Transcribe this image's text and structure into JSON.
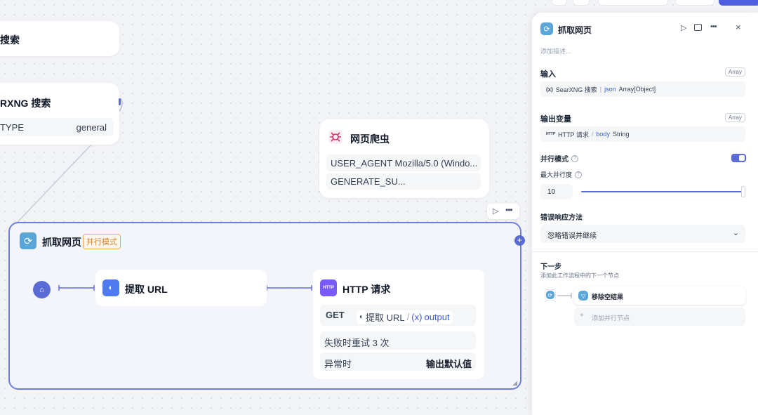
{
  "canvas": {
    "search_node": {
      "title": "搜索"
    },
    "searxng_node": {
      "title": "RXNG 搜索",
      "param_key": "TYPE",
      "param_value": "general"
    },
    "crawler_node": {
      "title": "网页爬虫",
      "rows": [
        "USER_AGENT Mozilla/5.0 (Windo...",
        "GENERATE_SU..."
      ]
    },
    "loop_node": {
      "title": "抓取网页",
      "badge": "并行模式",
      "extract_node": {
        "title": "提取 URL"
      },
      "http_node": {
        "icon_text": "HTTP",
        "title": "HTTP 请求",
        "method": "GET",
        "source_node": "提取 URL",
        "separator": "/",
        "var_icon": "(x)",
        "var_name": "output",
        "retry_text": "失败时重试 3 次",
        "error_label": "异常时",
        "error_value": "输出默认值"
      }
    }
  },
  "panel": {
    "title": "抓取网页",
    "description_placeholder": "添加描述...",
    "input_label": "输入",
    "input_type_badge": "Array",
    "input_var": {
      "icon": "(x)",
      "node": "SearXNG 搜索",
      "field": "json",
      "type": "Array[Object]"
    },
    "output_label": "输出变量",
    "output_type_badge": "Array",
    "output_var": {
      "icon": "HTTP",
      "node": "HTTP 请求",
      "field": "body",
      "type": "String"
    },
    "parallel_label": "并行模式",
    "parallel_enabled": true,
    "max_parallel_label": "最大并行度",
    "max_parallel_value": "10",
    "error_label": "错误响应方法",
    "error_option": "忽略错误并继续",
    "next_label": "下一步",
    "next_desc": "添加此工作流程中的下一个节点",
    "next_node": "移除空结果",
    "add_parallel": "添加并行节点",
    "help_glyph": "?"
  },
  "colors": {
    "accent": "#5b6bd5",
    "loop_border": "#6f7fd9",
    "badge_orange": "#d9822b",
    "crawler_pink": "#d6336c",
    "http_purple": "#7a5af8",
    "node_blue": "#4e7cf0"
  }
}
